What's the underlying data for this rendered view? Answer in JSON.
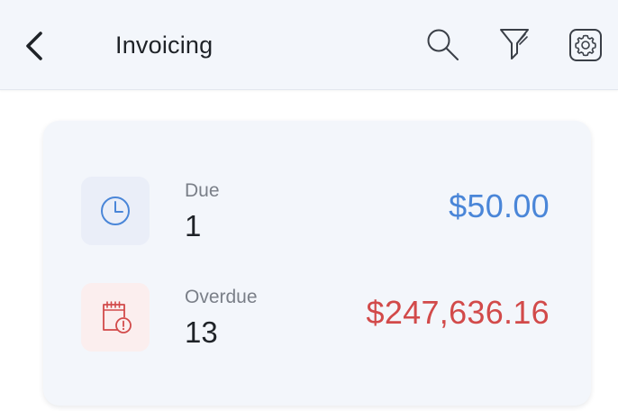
{
  "header": {
    "title": "Invoicing",
    "icons": {
      "back": "chevron-left-icon",
      "search": "search-icon",
      "filter": "filter-icon",
      "settings": "gear-icon"
    }
  },
  "summary": {
    "rows": [
      {
        "label": "Due",
        "count": "1",
        "amount": "$50.00",
        "icon": "clock-icon",
        "color": "#4a86d8",
        "icon_bg": "#eaeef8"
      },
      {
        "label": "Overdue",
        "count": "13",
        "amount": "$247,636.16",
        "icon": "overdue-calendar-icon",
        "color": "#d24a4a",
        "icon_bg": "#fbeeee"
      }
    ]
  },
  "colors": {
    "header_bg": "#f3f6fb",
    "card_bg": "#f3f6fb",
    "text_primary": "#1f2328",
    "text_secondary": "#7a7f88"
  }
}
